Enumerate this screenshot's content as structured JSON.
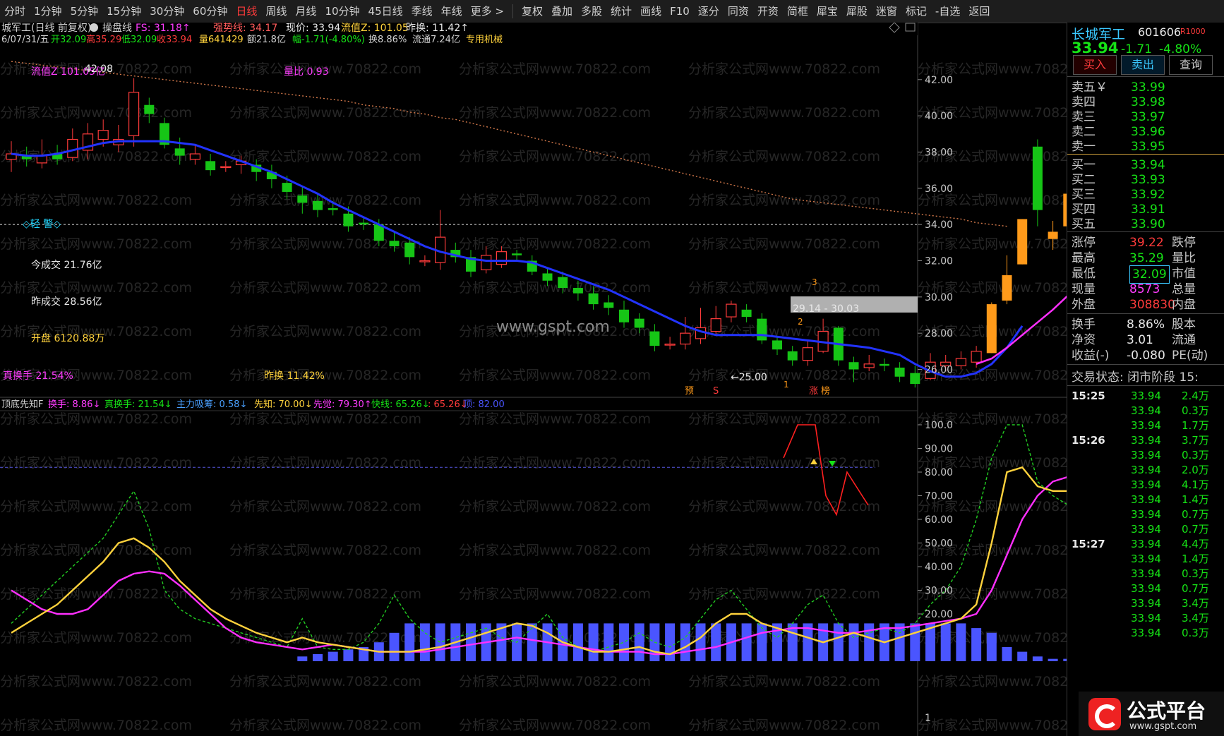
{
  "toolbar": {
    "items": [
      "分时",
      "1分钟",
      "5分钟",
      "15分钟",
      "30分钟",
      "60分钟",
      "日线",
      "周线",
      "月线",
      "10分钟",
      "45日线",
      "季线",
      "年线",
      "更多 >",
      "复权",
      "叠加",
      "多股",
      "统计",
      "画线",
      "F10",
      "逐分",
      "同资",
      "开资",
      "简框",
      "犀宝",
      "犀股",
      "迷窗",
      "标记",
      "-自选",
      "返回"
    ],
    "active": "日线"
  },
  "chart_header": {
    "title": "城军工(日线 前复权)",
    "indicator_name": "操盘线",
    "fs_label": "FS: 31.18↑",
    "strong_label": "强势线: 34.17",
    "now_label": "现价: 33.94",
    "liuzhi_label": "流值Z: 101.05",
    "zuohuan_label": "昨换: 11.42↑",
    "ohlc_line": "6/07/31/五",
    "ohlc_open": "开32.09",
    "ohlc_high": "高35.29",
    "ohlc_low": "低32.09",
    "ohlc_close": "收33.94",
    "ohlc_vol": "量641429",
    "ohlc_amt": "额21.8亿",
    "ohlc_chg": "幅-1.71(-4.80%)",
    "ohlc_turn": "换8.86%",
    "ohlc_float": "流通7.24亿",
    "ohlc_tag": "专用机械"
  },
  "annotations": {
    "liuzhi": "流值Z 101.05亿",
    "high_price": "42.08",
    "liangbi": "量比 0.93",
    "alert": "◇轻 警◇",
    "today_vol": "今成交 21.76亿",
    "yday_vol": "昨成交 28.56亿",
    "open_amt": "开盘 6120.88万",
    "real_turn": "真换手 21.54%",
    "yday_turn": "昨换 11.42%",
    "low_price": "←25.00",
    "zone": "29.14 - 30.03",
    "watermark": "www.gspt.com",
    "watermark2": "分析家公式网www.70822.com",
    "mark1": "1",
    "mark2": "2",
    "mark3": "3",
    "mark4": "1",
    "tag_yu": "预",
    "tag_s": "S",
    "tag_zhang": "涨",
    "tag_bang": "榜"
  },
  "lower_header": {
    "name": "顶底先知F",
    "huanshou": "换手: 8.86↓",
    "zhen": "真换手: 21.54↓",
    "zhuli": "主力吸筹: 0.58↓",
    "xianzhi": "先知: 70.00↓",
    "xianjue": "先觉: 79.30↑",
    "kuaixian": "快线: 65.26↓",
    "red": ": 65.26↓",
    "ding": "顶: 82.00"
  },
  "axes": {
    "main_ticks": [
      "42.00",
      "40.00",
      "38.00",
      "36.00",
      "34.00",
      "32.00",
      "30.00",
      "28.00",
      "26.00"
    ],
    "sub_ticks": [
      "100.0",
      "90.00",
      "80.00",
      "70.00",
      "60.00",
      "50.00",
      "40.00",
      "30.00",
      "20.00",
      "1"
    ]
  },
  "quote": {
    "name": "长城军工",
    "code": "601606",
    "badge": "R1000",
    "price": "33.94",
    "change": "-1.71",
    "pct": "-4.80%",
    "buy_btn": "买入",
    "sell_btn": "卖出",
    "query_btn": "查询",
    "asks": [
      {
        "label": "卖五￥",
        "price": "33.99"
      },
      {
        "label": "卖四",
        "price": "33.98"
      },
      {
        "label": "卖三",
        "price": "33.97"
      },
      {
        "label": "卖二",
        "price": "33.96"
      },
      {
        "label": "卖一",
        "price": "33.95"
      }
    ],
    "bids": [
      {
        "label": "买一",
        "price": "33.94"
      },
      {
        "label": "买二",
        "price": "33.93"
      },
      {
        "label": "买三",
        "price": "33.92"
      },
      {
        "label": "买四",
        "price": "33.91"
      },
      {
        "label": "买五",
        "price": "33.90"
      }
    ],
    "stats": [
      {
        "l": "涨停",
        "v": "39.22",
        "r": "跌停"
      },
      {
        "l": "最高",
        "v": "35.29",
        "r": "量比"
      },
      {
        "l": "最低",
        "v": "32.09",
        "r": "市值"
      },
      {
        "l": "现量",
        "v": "8573",
        "r": "总量"
      },
      {
        "l": "外盘",
        "v": "308830",
        "r": "内盘"
      }
    ],
    "stats2": [
      {
        "l": "换手",
        "v": "8.86%",
        "r": "股本"
      },
      {
        "l": "净资",
        "v": "3.01",
        "r": "流通"
      },
      {
        "l": "收益(-)",
        "v": "-0.080",
        "r": "PE(动)"
      }
    ],
    "status": "交易状态: 闭市阶段 15:",
    "ticks": [
      {
        "t": "15:25",
        "p": "33.94",
        "v": "2.4万"
      },
      {
        "t": "",
        "p": "33.94",
        "v": "0.3万"
      },
      {
        "t": "",
        "p": "33.94",
        "v": "1.7万"
      },
      {
        "t": "15:26",
        "p": "33.94",
        "v": "3.7万"
      },
      {
        "t": "",
        "p": "33.94",
        "v": "0.3万"
      },
      {
        "t": "",
        "p": "33.94",
        "v": "2.0万"
      },
      {
        "t": "",
        "p": "33.94",
        "v": "4.1万"
      },
      {
        "t": "",
        "p": "33.94",
        "v": "1.4万"
      },
      {
        "t": "",
        "p": "33.94",
        "v": "0.7万"
      },
      {
        "t": "",
        "p": "33.94",
        "v": "0.7万"
      },
      {
        "t": "15:27",
        "p": "33.94",
        "v": "4.4万"
      },
      {
        "t": "",
        "p": "33.94",
        "v": "1.4万"
      },
      {
        "t": "",
        "p": "33.94",
        "v": "0.3万"
      },
      {
        "t": "",
        "p": "33.94",
        "v": "0.7万"
      },
      {
        "t": "",
        "p": "33.94",
        "v": "3.4万"
      },
      {
        "t": "",
        "p": "33.94",
        "v": "3.4万"
      },
      {
        "t": "",
        "p": "33.94",
        "v": "0.3万"
      }
    ]
  },
  "logo": {
    "text": "公式平台",
    "url": "www.gspt.com"
  },
  "chart_data": {
    "type": "candlestick",
    "ylim": [
      24.5,
      43.2
    ],
    "candles": [
      [
        37.6,
        37.9,
        38.6,
        36.9
      ],
      [
        37.8,
        37.6,
        38.3,
        37.2
      ],
      [
        37.4,
        37.8,
        38.7,
        37.1
      ],
      [
        37.9,
        37.6,
        38.4,
        37.3
      ],
      [
        37.7,
        38.7,
        39.3,
        37.5
      ],
      [
        38.1,
        39.0,
        39.6,
        37.6
      ],
      [
        38.7,
        39.2,
        39.8,
        38.3
      ],
      [
        38.4,
        38.7,
        39.5,
        38.0
      ],
      [
        38.9,
        41.3,
        42.08,
        38.3
      ],
      [
        40.6,
        40.1,
        41.0,
        39.6
      ],
      [
        39.6,
        38.4,
        39.9,
        38.2
      ],
      [
        38.2,
        37.8,
        38.8,
        37.3
      ],
      [
        37.6,
        37.9,
        38.4,
        37.3
      ],
      [
        37.5,
        37.0,
        37.9,
        36.7
      ],
      [
        37.2,
        37.2,
        37.5,
        36.9
      ],
      [
        37.3,
        37.5,
        37.8,
        36.8
      ],
      [
        37.3,
        36.9,
        37.6,
        36.4
      ],
      [
        36.9,
        36.5,
        37.3,
        36.0
      ],
      [
        36.3,
        35.8,
        36.7,
        35.4
      ],
      [
        35.6,
        35.2,
        36.1,
        34.6
      ],
      [
        35.3,
        34.8,
        35.7,
        34.4
      ],
      [
        34.9,
        34.8,
        35.3,
        34.5
      ],
      [
        34.6,
        33.9,
        35.0,
        33.6
      ],
      [
        34.1,
        34.0,
        34.4,
        33.7
      ],
      [
        34.0,
        33.1,
        34.3,
        32.8
      ],
      [
        33.1,
        32.8,
        33.6,
        32.5
      ],
      [
        33.0,
        32.2,
        33.3,
        31.8
      ],
      [
        32.0,
        32.0,
        32.3,
        31.7
      ],
      [
        31.9,
        33.3,
        34.8,
        31.5
      ],
      [
        32.6,
        32.2,
        33.0,
        31.9
      ],
      [
        32.2,
        31.4,
        32.6,
        31.1
      ],
      [
        31.5,
        32.3,
        32.8,
        31.3
      ],
      [
        31.8,
        32.5,
        32.8,
        31.6
      ],
      [
        32.4,
        32.3,
        32.6,
        32.0
      ],
      [
        32.0,
        31.4,
        32.3,
        31.2
      ],
      [
        31.3,
        30.9,
        31.6,
        30.6
      ],
      [
        31.1,
        30.5,
        31.4,
        30.2
      ],
      [
        30.5,
        30.2,
        30.9,
        29.8
      ],
      [
        30.2,
        29.6,
        30.6,
        29.3
      ],
      [
        29.7,
        29.4,
        30.1,
        29.0
      ],
      [
        29.3,
        28.6,
        29.8,
        28.3
      ],
      [
        28.8,
        28.3,
        29.1,
        28.0
      ],
      [
        28.1,
        27.3,
        28.5,
        27.0
      ],
      [
        27.4,
        27.4,
        27.8,
        27.1
      ],
      [
        27.4,
        28.0,
        28.9,
        27.1
      ],
      [
        27.7,
        28.3,
        29.4,
        27.4
      ],
      [
        28.1,
        28.8,
        29.5,
        27.9
      ],
      [
        28.9,
        29.6,
        29.8,
        28.6
      ],
      [
        29.3,
        28.9,
        29.6,
        28.6
      ],
      [
        28.8,
        27.6,
        29.1,
        27.4
      ],
      [
        27.6,
        27.1,
        27.8,
        26.8
      ],
      [
        27.0,
        26.5,
        27.3,
        26.2
      ],
      [
        26.5,
        27.2,
        27.6,
        26.2
      ],
      [
        27.0,
        28.1,
        28.8,
        26.9
      ],
      [
        28.3,
        26.5,
        28.4,
        26.2
      ],
      [
        26.4,
        26.0,
        26.7,
        25.3
      ],
      [
        26.1,
        26.3,
        26.8,
        25.9
      ],
      [
        26.3,
        26.2,
        26.6,
        25.9
      ],
      [
        26.1,
        25.6,
        26.4,
        25.3
      ],
      [
        25.8,
        25.2,
        26.2,
        25.0
      ],
      [
        25.5,
        26.4,
        26.9,
        25.4
      ],
      [
        26.2,
        26.4,
        26.8,
        25.9
      ],
      [
        26.2,
        26.6,
        27.0,
        26.0
      ],
      [
        26.4,
        27.0,
        27.3,
        26.1
      ],
      [
        26.9,
        29.6,
        29.7,
        26.9
      ],
      [
        29.8,
        31.2,
        32.3,
        29.6
      ],
      [
        31.8,
        34.3,
        34.3,
        31.8
      ],
      [
        38.3,
        34.8,
        38.7,
        33.9
      ],
      [
        33.2,
        33.6,
        34.2,
        32.6
      ],
      [
        33.9,
        35.7,
        36.1,
        32.1
      ],
      [
        34.1,
        32.2,
        35.2,
        32.0
      ]
    ],
    "ma_blue": [
      37.9,
      37.8,
      37.8,
      37.9,
      38.1,
      38.3,
      38.5,
      38.6,
      38.6,
      38.6,
      38.6,
      38.5,
      38.4,
      38.1,
      37.8,
      37.5,
      37.2,
      36.9,
      36.5,
      36.1,
      35.7,
      35.2,
      34.8,
      34.4,
      34.0,
      33.6,
      33.2,
      32.8,
      32.5,
      32.3,
      32.1,
      32.0,
      32.0,
      32.0,
      31.9,
      31.6,
      31.3,
      31.0,
      30.7,
      30.4,
      30.0,
      29.6,
      29.2,
      28.8,
      28.4,
      28.1,
      27.9,
      27.9,
      27.9,
      27.9,
      27.8,
      27.7,
      27.6,
      27.5,
      27.4,
      27.3,
      27.2,
      27.0,
      26.8,
      26.3,
      25.9,
      25.6,
      25.6,
      25.8,
      26.3,
      27.2,
      28.4,
      null,
      null,
      null,
      null
    ],
    "ma_orange": [
      43.0,
      42.9,
      42.8,
      42.7,
      42.6,
      42.5,
      42.4,
      42.3,
      42.2,
      42.1,
      42.0,
      41.9,
      41.8,
      41.7,
      41.6,
      41.5,
      41.4,
      41.3,
      41.2,
      41.1,
      41.0,
      40.9,
      40.8,
      40.6,
      40.5,
      40.4,
      40.2,
      40.1,
      39.9,
      39.8,
      39.6,
      39.4,
      39.2,
      39.0,
      38.8,
      38.6,
      38.4,
      38.2,
      38.0,
      37.8,
      37.6,
      37.4,
      37.2,
      37.0,
      36.8,
      36.6,
      36.4,
      36.2,
      36.0,
      35.8,
      35.6,
      35.4,
      35.3,
      35.2,
      35.1,
      35.0,
      34.9,
      34.8,
      34.7,
      34.6,
      34.5,
      34.4,
      34.3,
      34.1,
      34.0,
      33.9,
      null,
      null,
      null,
      null,
      null
    ],
    "ma_magenta": [
      null,
      null,
      null,
      null,
      null,
      null,
      null,
      null,
      null,
      null,
      null,
      null,
      null,
      null,
      null,
      null,
      null,
      null,
      null,
      null,
      null,
      null,
      null,
      null,
      null,
      null,
      null,
      null,
      null,
      null,
      null,
      null,
      null,
      null,
      null,
      null,
      null,
      null,
      null,
      null,
      null,
      null,
      null,
      null,
      null,
      null,
      null,
      null,
      null,
      null,
      null,
      null,
      null,
      null,
      null,
      null,
      null,
      null,
      null,
      null,
      null,
      null,
      null,
      26.3,
      26.6,
      27.2,
      27.9,
      28.6,
      29.3,
      30.1,
      30.9
    ],
    "sub": {
      "ylim": [
        0,
        100
      ],
      "bars": [
        0,
        0,
        0,
        0,
        0,
        0,
        0,
        0,
        0,
        0,
        0,
        0,
        0,
        0,
        0,
        0,
        0,
        0,
        0,
        2,
        3,
        4,
        5,
        6,
        8,
        12,
        16,
        16,
        16,
        16,
        16,
        16,
        16,
        16,
        16,
        16,
        16,
        16,
        16,
        16,
        16,
        16,
        16,
        16,
        16,
        16,
        16,
        16,
        16,
        16,
        16,
        16,
        16,
        16,
        16,
        16,
        16,
        16,
        16,
        16,
        16,
        16,
        16,
        14,
        12,
        6,
        4,
        2,
        1,
        1,
        1
      ],
      "yellow": [
        12,
        16,
        20,
        24,
        30,
        36,
        42,
        50,
        52,
        48,
        42,
        34,
        28,
        22,
        18,
        15,
        12,
        10,
        8,
        10,
        8,
        7,
        6,
        5,
        4,
        4,
        4,
        5,
        6,
        8,
        10,
        12,
        14,
        16,
        15,
        12,
        8,
        6,
        4,
        4,
        5,
        6,
        4,
        3,
        6,
        10,
        16,
        20,
        20,
        16,
        14,
        12,
        10,
        8,
        10,
        12,
        10,
        8,
        10,
        12,
        14,
        16,
        18,
        24,
        50,
        80,
        82,
        74,
        72,
        72,
        70
      ],
      "magenta": [
        30,
        26,
        22,
        20,
        20,
        22,
        28,
        34,
        37,
        38,
        37,
        32,
        26,
        20,
        14,
        10,
        8,
        7,
        6,
        5,
        6,
        7,
        6,
        5,
        4,
        4,
        4,
        4,
        5,
        6,
        7,
        8,
        9,
        10,
        9,
        8,
        7,
        6,
        5,
        4,
        4,
        4,
        3,
        3,
        4,
        5,
        6,
        8,
        10,
        12,
        13,
        14,
        14,
        13,
        12,
        12,
        13,
        14,
        14,
        15,
        16,
        17,
        18,
        20,
        30,
        45,
        60,
        70,
        76,
        78,
        79
      ],
      "green": [
        16,
        22,
        28,
        34,
        40,
        46,
        52,
        62,
        72,
        56,
        30,
        22,
        18,
        16,
        14,
        12,
        10,
        8,
        6,
        18,
        6,
        5,
        5,
        8,
        16,
        28,
        18,
        12,
        8,
        10,
        12,
        14,
        10,
        8,
        14,
        20,
        10,
        6,
        4,
        6,
        8,
        12,
        8,
        6,
        10,
        18,
        26,
        30,
        22,
        14,
        10,
        16,
        24,
        28,
        16,
        10,
        12,
        14,
        12,
        16,
        24,
        30,
        40,
        60,
        86,
        100,
        100,
        76,
        70,
        66,
        62
      ]
    }
  }
}
